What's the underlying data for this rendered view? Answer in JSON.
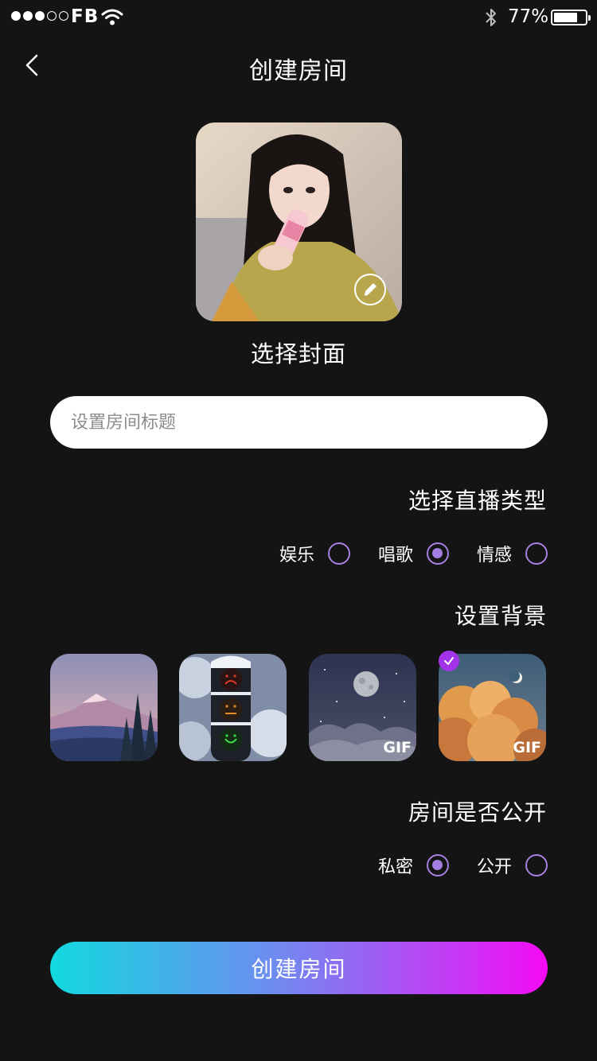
{
  "status_bar": {
    "carrier": "FB",
    "battery_percent": "77%",
    "battery_level": 0.77,
    "signal_bars_filled": 3,
    "signal_bars_total": 5
  },
  "header": {
    "title": "创建房间",
    "back_icon": "chevron-left-icon"
  },
  "cover": {
    "label": "选择封面",
    "edit_icon": "pencil-icon"
  },
  "title_input": {
    "placeholder": "设置房间标题",
    "value": ""
  },
  "live_type": {
    "title": "选择直播类型",
    "options": [
      {
        "label": "娱乐",
        "selected": false
      },
      {
        "label": "唱歌",
        "selected": true
      },
      {
        "label": "情感",
        "selected": false
      }
    ]
  },
  "background": {
    "title": "设置背景",
    "items": [
      {
        "name": "mountain",
        "gif_label": "",
        "selected": false
      },
      {
        "name": "traffic-light",
        "gif_label": "",
        "selected": false
      },
      {
        "name": "night-sky",
        "gif_label": "GIF",
        "selected": false
      },
      {
        "name": "clouds",
        "gif_label": "GIF",
        "selected": true
      }
    ]
  },
  "visibility": {
    "title": "房间是否公开",
    "options": [
      {
        "label": "私密",
        "selected": true
      },
      {
        "label": "公开",
        "selected": false
      }
    ]
  },
  "create_button": {
    "label": "创建房间"
  },
  "colors": {
    "background": "#141414",
    "accent_purple": "#a57fe0",
    "check_badge": "#a233e8",
    "gradient_start": "#12d9df",
    "gradient_end": "#f50af4"
  }
}
